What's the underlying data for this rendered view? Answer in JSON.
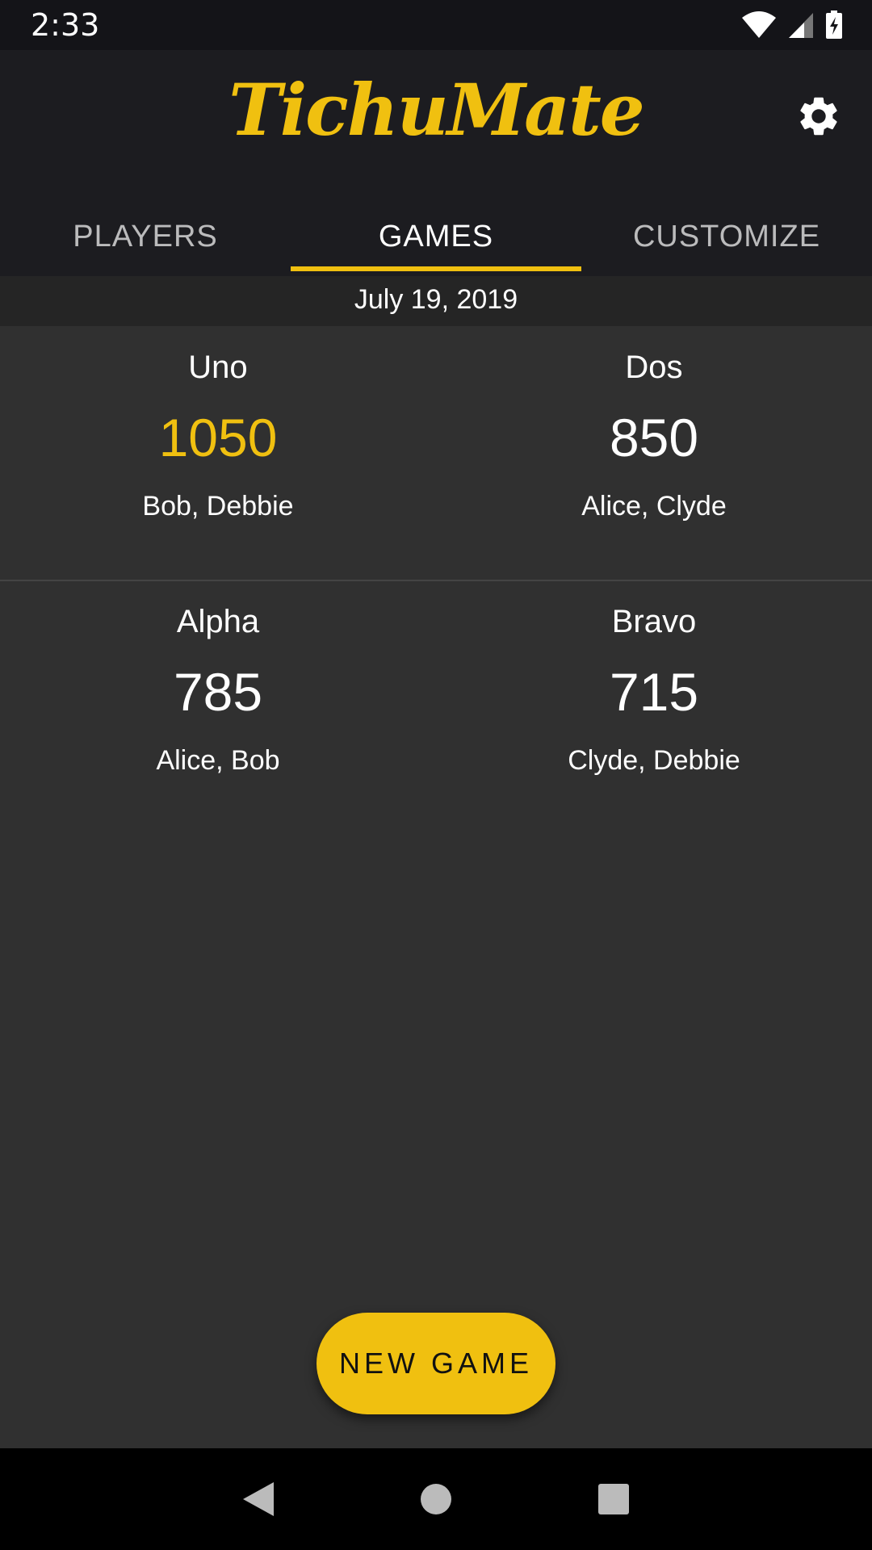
{
  "status_bar": {
    "time": "2:33",
    "icons": [
      "wifi-icon",
      "cell-signal-icon",
      "battery-charging-icon"
    ]
  },
  "app_bar": {
    "logo_text": "TichuMate",
    "settings_icon": "gear-icon",
    "accent_color": "#f0c010"
  },
  "tabs": [
    {
      "label": "PLAYERS",
      "active": false
    },
    {
      "label": "GAMES",
      "active": true
    },
    {
      "label": "CUSTOMIZE",
      "active": false
    }
  ],
  "date_header": "July 19, 2019",
  "games": [
    {
      "team_a": {
        "name": "Uno",
        "score": "1050",
        "players": "Bob, Debbie",
        "winner": true
      },
      "team_b": {
        "name": "Dos",
        "score": "850",
        "players": "Alice, Clyde",
        "winner": false
      }
    },
    {
      "team_a": {
        "name": "Alpha",
        "score": "785",
        "players": "Alice, Bob",
        "winner": false
      },
      "team_b": {
        "name": "Bravo",
        "score": "715",
        "players": "Clyde, Debbie",
        "winner": false
      }
    }
  ],
  "fab_label": "NEW GAME",
  "nav_bar": [
    "back-icon",
    "home-icon",
    "recents-icon"
  ]
}
